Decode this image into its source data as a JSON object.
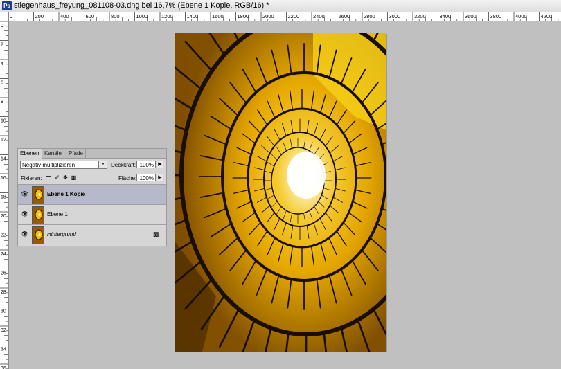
{
  "window": {
    "app_badge": "Ps",
    "title": "stiegenhaus_freyung_081108-03.dng bei 16,7% (Ebene 1 Kopie, RGB/16) *"
  },
  "rulers": {
    "horizontal_labels": [
      "0",
      "200",
      "400",
      "600",
      "800",
      "1000",
      "1200",
      "1400",
      "1600",
      "1800",
      "2000",
      "2200",
      "2400",
      "2600",
      "2800",
      "3000",
      "3200",
      "3400",
      "3600",
      "3800",
      "4000",
      "4200"
    ],
    "vertical_labels": [
      "0",
      "2",
      "4",
      "6",
      "8",
      "10",
      "12",
      "14",
      "16",
      "18",
      "20",
      "22",
      "24",
      "26",
      "28",
      "30",
      "32",
      "34",
      "36"
    ]
  },
  "layers_panel": {
    "tabs": [
      {
        "label": "Ebenen",
        "active": true
      },
      {
        "label": "Kanäle",
        "active": false
      },
      {
        "label": "Pfade",
        "active": false
      }
    ],
    "blend_mode": "Negativ multiplizieren",
    "opacity_label": "Deckkraft:",
    "opacity_value": "100%",
    "fix_label": "Fixieren:",
    "fill_label": "Fläche:",
    "fill_value": "100%",
    "layers": [
      {
        "name": "Ebene 1 Kopie",
        "selected": true,
        "visible": true,
        "locked": false,
        "bold": true,
        "italic": false
      },
      {
        "name": "Ebene 1",
        "selected": false,
        "visible": true,
        "locked": false,
        "bold": false,
        "italic": false
      },
      {
        "name": "Hintergrund",
        "selected": false,
        "visible": true,
        "locked": true,
        "bold": false,
        "italic": true
      }
    ]
  },
  "icons": {
    "eye": "eye-icon",
    "lock": "lock-icon",
    "dropdown": "chevron-down-icon",
    "stepper": "chevron-right-icon"
  },
  "colors": {
    "workspace": "#c0c0c0",
    "selected_layer": "#b6b9c9",
    "image_yellow": "#f5c400",
    "image_amber": "#c98a00",
    "railing": "#1a0e00"
  }
}
